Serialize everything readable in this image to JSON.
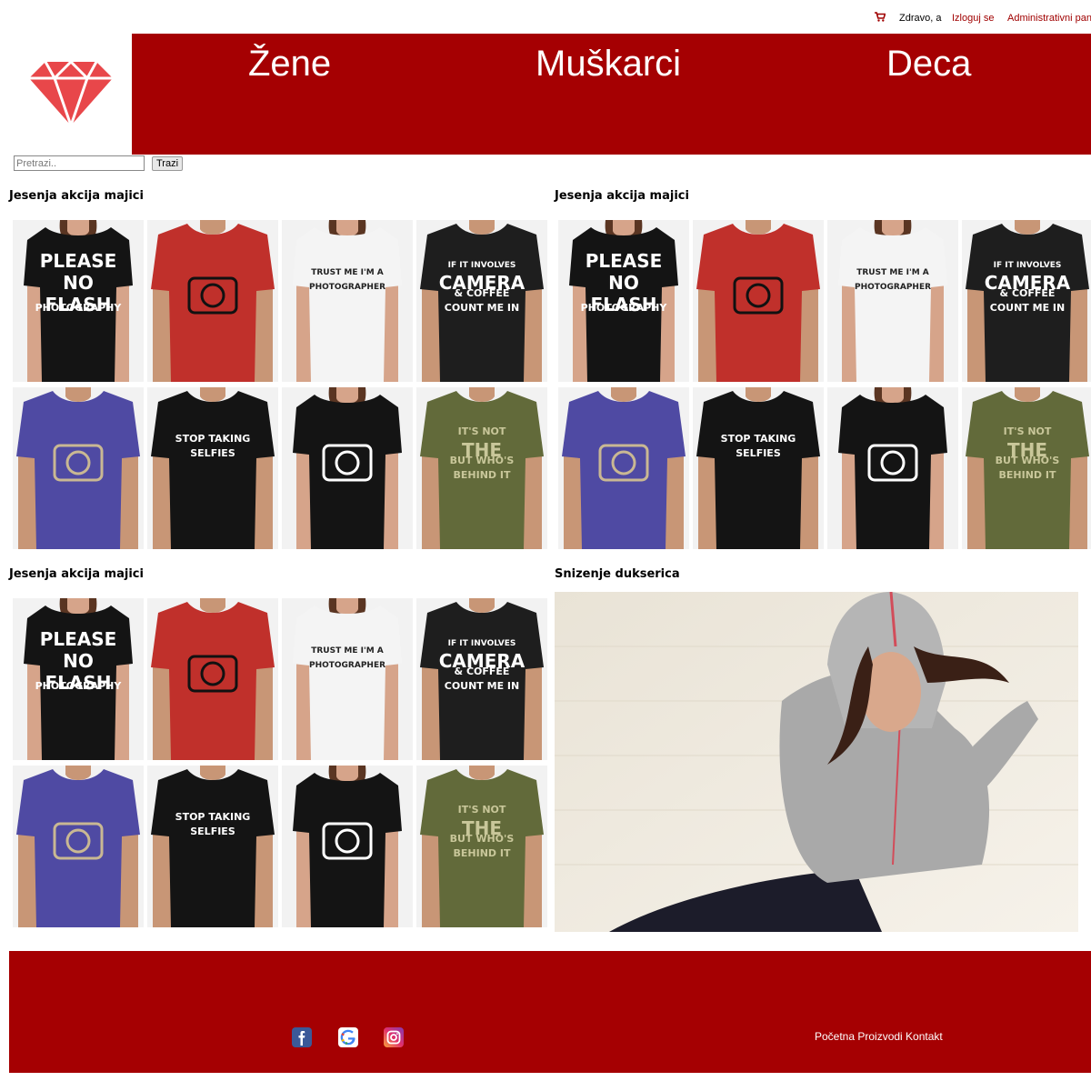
{
  "topbar": {
    "cart_icon": "cart-icon",
    "greeting": "Zdravo, a",
    "logout": "Izloguj se",
    "admin": "Administrativni pane"
  },
  "brand": {
    "logo_icon": "diamond-icon",
    "color": "#a50002"
  },
  "nav": {
    "items": [
      "Žene",
      "Muškarci",
      "Deca"
    ]
  },
  "search": {
    "placeholder": "Pretrazi..",
    "button": "Trazi"
  },
  "sections": [
    {
      "title": "Jesenja akcija majici"
    },
    {
      "title": "Jesenja akcija majici"
    },
    {
      "title": "Jesenja akcija majici"
    },
    {
      "title": "Snizenje dukserica"
    }
  ],
  "products": [
    {
      "shirt_color": "#141414",
      "model": "woman",
      "print": [
        "PLEASE",
        "NO",
        "FLASH",
        "PHOTOGRAPHY"
      ],
      "print_color": "#ffffff"
    },
    {
      "shirt_color": "#c0302b",
      "model": "man",
      "print": [],
      "print_color": "#111111"
    },
    {
      "shirt_color": "#f4f4f4",
      "model": "woman",
      "print": [
        "TRUST ME I'M A",
        "PHOTOGRAPHER"
      ],
      "print_color": "#222222"
    },
    {
      "shirt_color": "#1e1e1e",
      "model": "man",
      "print": [
        "IF IT INVOLVES",
        "CAMERA",
        "& COFFEE",
        "COUNT ME IN"
      ],
      "print_color": "#ffffff"
    },
    {
      "shirt_color": "#4f4aa3",
      "model": "man",
      "print": [],
      "print_color": "#c9b893"
    },
    {
      "shirt_color": "#141414",
      "model": "man",
      "print": [
        "STOP TAKING",
        "SELFIES"
      ],
      "print_color": "#ffffff"
    },
    {
      "shirt_color": "#141414",
      "model": "woman",
      "print": [],
      "print_color": "#ffffff"
    },
    {
      "shirt_color": "#626a3a",
      "model": "man",
      "print": [
        "IT'S NOT",
        "THE",
        "BUT WHO'S",
        "BEHIND IT"
      ],
      "print_color": "#c9c79a"
    }
  ],
  "footer": {
    "social": [
      "facebook-icon",
      "google-icon",
      "instagram-icon"
    ],
    "links": "Početna Proizvodi Kontakt"
  }
}
